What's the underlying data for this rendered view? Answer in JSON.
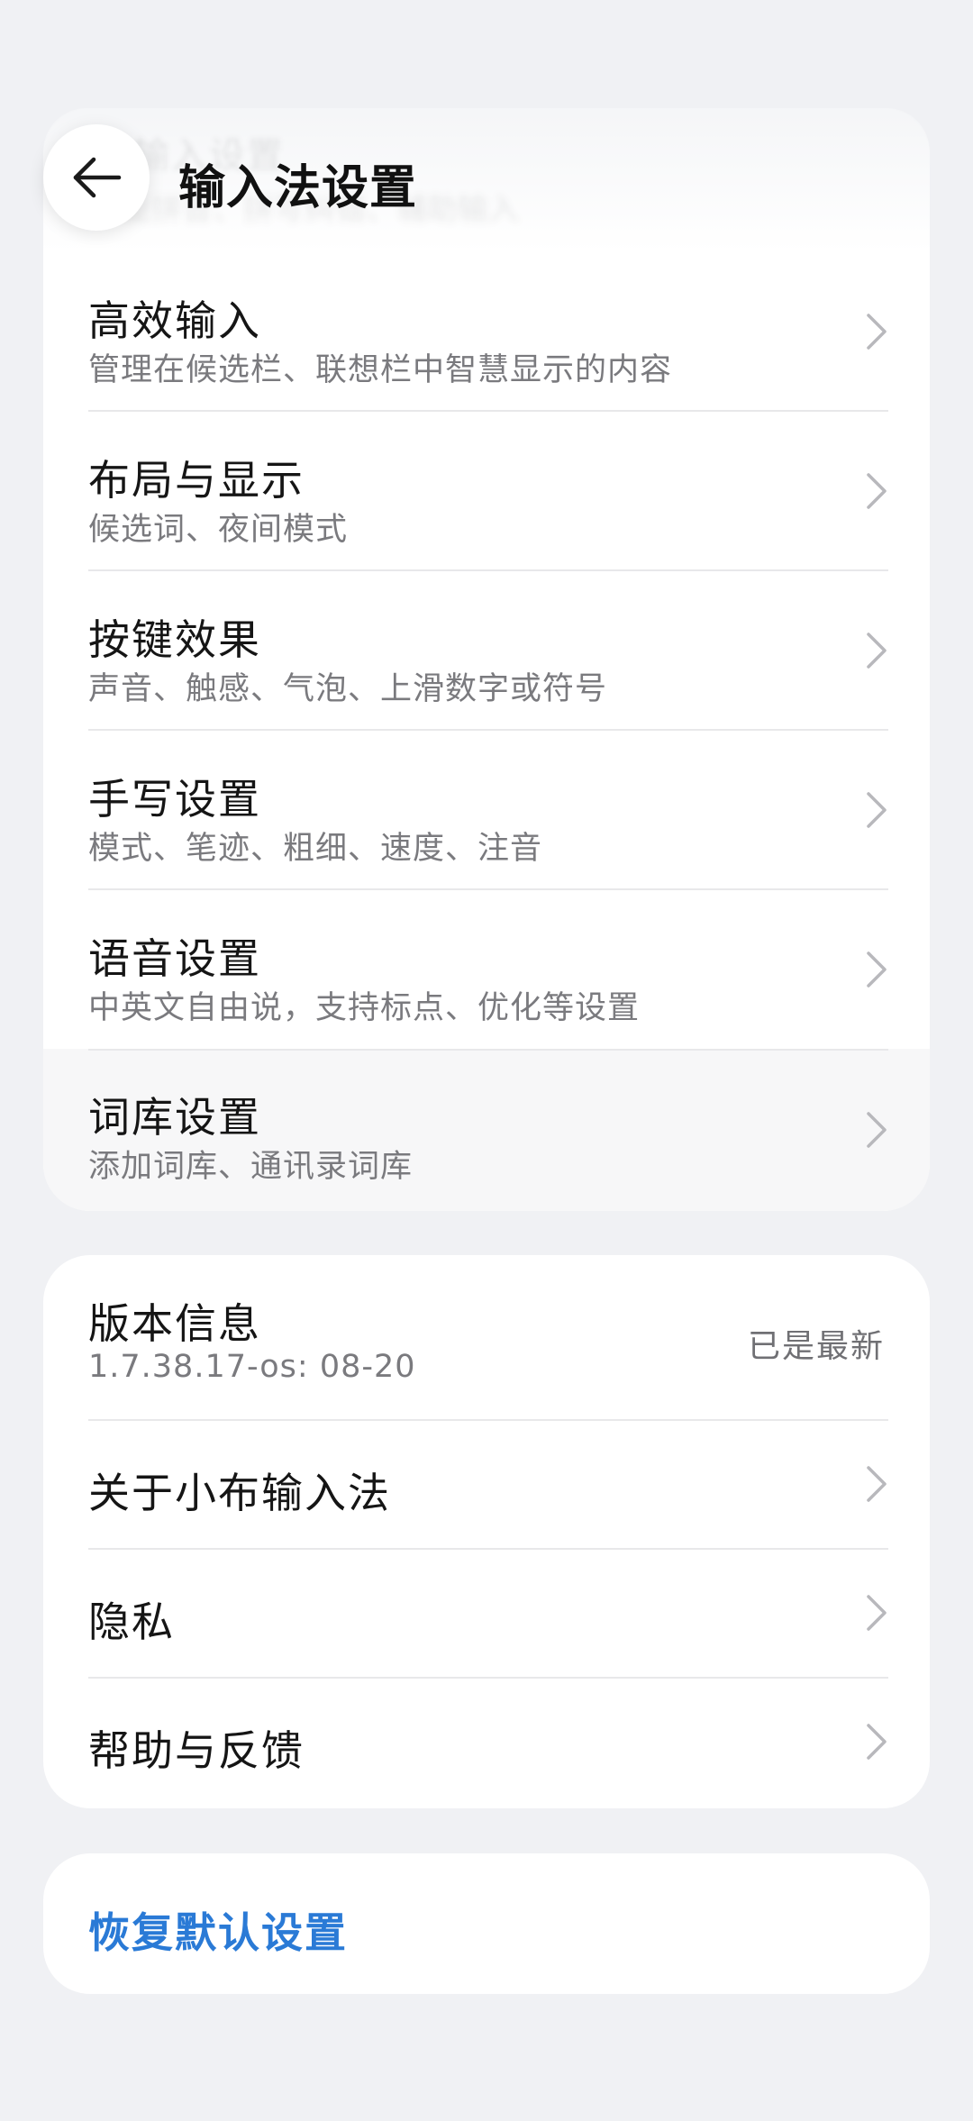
{
  "header": {
    "title": "输入法设置",
    "ghost_title": "输入设置",
    "ghost_subtitle": "智能拼音、拼写纠错、辅助输入"
  },
  "settings": {
    "items": [
      {
        "title": "高效输入",
        "subtitle": "管理在候选栏、联想栏中智慧显示的内容"
      },
      {
        "title": "布局与显示",
        "subtitle": "候选词、夜间模式"
      },
      {
        "title": "按键效果",
        "subtitle": "声音、触感、气泡、上滑数字或符号"
      },
      {
        "title": "手写设置",
        "subtitle": "模式、笔迹、粗细、速度、注音"
      },
      {
        "title": "语音设置",
        "subtitle": "中英文自由说，支持标点、优化等设置"
      },
      {
        "title": "词库设置",
        "subtitle": "添加词库、通讯录词库"
      }
    ]
  },
  "info": {
    "version_title": "版本信息",
    "version_number": "1.7.38.17-os: 08-20",
    "version_status": "已是最新",
    "items": [
      {
        "title": "关于小布输入法"
      },
      {
        "title": "隐私"
      },
      {
        "title": "帮助与反馈"
      }
    ]
  },
  "reset": {
    "label": "恢复默认设置"
  },
  "icons": {
    "back": "arrow-left-icon",
    "chevron": "chevron-right-icon"
  },
  "colors": {
    "background": "#f0f1f4",
    "card": "#ffffff",
    "accent": "#2a7ad6"
  }
}
